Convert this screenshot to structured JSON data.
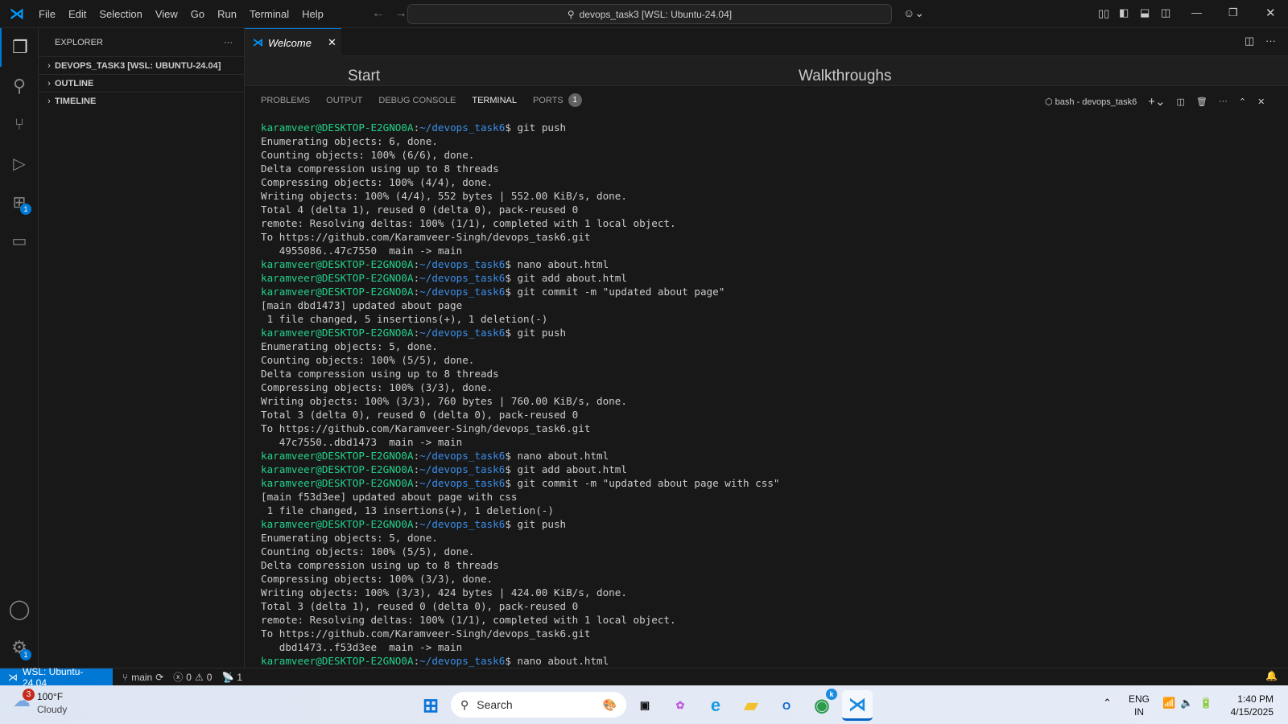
{
  "titlebar": {
    "menus": [
      "File",
      "Edit",
      "Selection",
      "View",
      "Go",
      "Run",
      "Terminal",
      "Help"
    ],
    "search": "devops_task3 [WSL: Ubuntu-24.04]"
  },
  "sidebar": {
    "title": "EXPLORER",
    "sections": [
      "DEVOPS_TASK3 [WSL: UBUNTU-24.04]",
      "OUTLINE",
      "TIMELINE"
    ]
  },
  "activity": {
    "extensions_badge": "1",
    "settings_badge": "1"
  },
  "editor": {
    "tab": "Welcome",
    "start": "Start",
    "walkthroughs": "Walkthroughs"
  },
  "panel": {
    "tabs": [
      "PROBLEMS",
      "OUTPUT",
      "DEBUG CONSOLE",
      "TERMINAL",
      "PORTS"
    ],
    "ports_badge": "1",
    "terminal_name": "bash - devops_task6"
  },
  "terminal": {
    "user": "karamveer@DESKTOP-E2GNO0A",
    "path": "~/devops_task6",
    "lines": [
      {
        "cmd": "git push"
      },
      {
        "text": "Enumerating objects: 6, done."
      },
      {
        "text": "Counting objects: 100% (6/6), done."
      },
      {
        "text": "Delta compression using up to 8 threads"
      },
      {
        "text": "Compressing objects: 100% (4/4), done."
      },
      {
        "text": "Writing objects: 100% (4/4), 552 bytes | 552.00 KiB/s, done."
      },
      {
        "text": "Total 4 (delta 1), reused 0 (delta 0), pack-reused 0"
      },
      {
        "text": "remote: Resolving deltas: 100% (1/1), completed with 1 local object."
      },
      {
        "text": "To https://github.com/Karamveer-Singh/devops_task6.git"
      },
      {
        "text": "   4955086..47c7550  main -> main"
      },
      {
        "cmd": "nano about.html"
      },
      {
        "cmd": "git add about.html"
      },
      {
        "cmd": "git commit -m \"updated about page\""
      },
      {
        "text": "[main dbd1473] updated about page"
      },
      {
        "text": " 1 file changed, 5 insertions(+), 1 deletion(-)"
      },
      {
        "cmd": "git push"
      },
      {
        "text": "Enumerating objects: 5, done."
      },
      {
        "text": "Counting objects: 100% (5/5), done."
      },
      {
        "text": "Delta compression using up to 8 threads"
      },
      {
        "text": "Compressing objects: 100% (3/3), done."
      },
      {
        "text": "Writing objects: 100% (3/3), 760 bytes | 760.00 KiB/s, done."
      },
      {
        "text": "Total 3 (delta 0), reused 0 (delta 0), pack-reused 0"
      },
      {
        "text": "To https://github.com/Karamveer-Singh/devops_task6.git"
      },
      {
        "text": "   47c7550..dbd1473  main -> main"
      },
      {
        "cmd": "nano about.html"
      },
      {
        "cmd": "git add about.html"
      },
      {
        "cmd": "git commit -m \"updated about page with css\""
      },
      {
        "text": "[main f53d3ee] updated about page with css"
      },
      {
        "text": " 1 file changed, 13 insertions(+), 1 deletion(-)"
      },
      {
        "cmd": "git push"
      },
      {
        "text": "Enumerating objects: 5, done."
      },
      {
        "text": "Counting objects: 100% (5/5), done."
      },
      {
        "text": "Delta compression using up to 8 threads"
      },
      {
        "text": "Compressing objects: 100% (3/3), done."
      },
      {
        "text": "Writing objects: 100% (3/3), 424 bytes | 424.00 KiB/s, done."
      },
      {
        "text": "Total 3 (delta 1), reused 0 (delta 0), pack-reused 0"
      },
      {
        "text": "remote: Resolving deltas: 100% (1/1), completed with 1 local object."
      },
      {
        "text": "To https://github.com/Karamveer-Singh/devops_task6.git"
      },
      {
        "text": "   dbd1473..f53d3ee  main -> main"
      },
      {
        "cmd": "nano about.html"
      }
    ]
  },
  "status": {
    "remote": "WSL: Ubuntu-24.04",
    "branch": "main",
    "errors": "0",
    "warnings": "0",
    "ports": "1"
  },
  "taskbar": {
    "weather_temp": "100°F",
    "weather_desc": "Cloudy",
    "weather_badge": "3",
    "search": "Search",
    "lang1": "ENG",
    "lang2": "IN",
    "time": "1:40 PM",
    "date": "4/15/2025",
    "chrome_badge": "k"
  },
  "colors": {
    "accent": "#0078d4",
    "prompt_user": "#23d18b",
    "prompt_path": "#3b8eea"
  }
}
